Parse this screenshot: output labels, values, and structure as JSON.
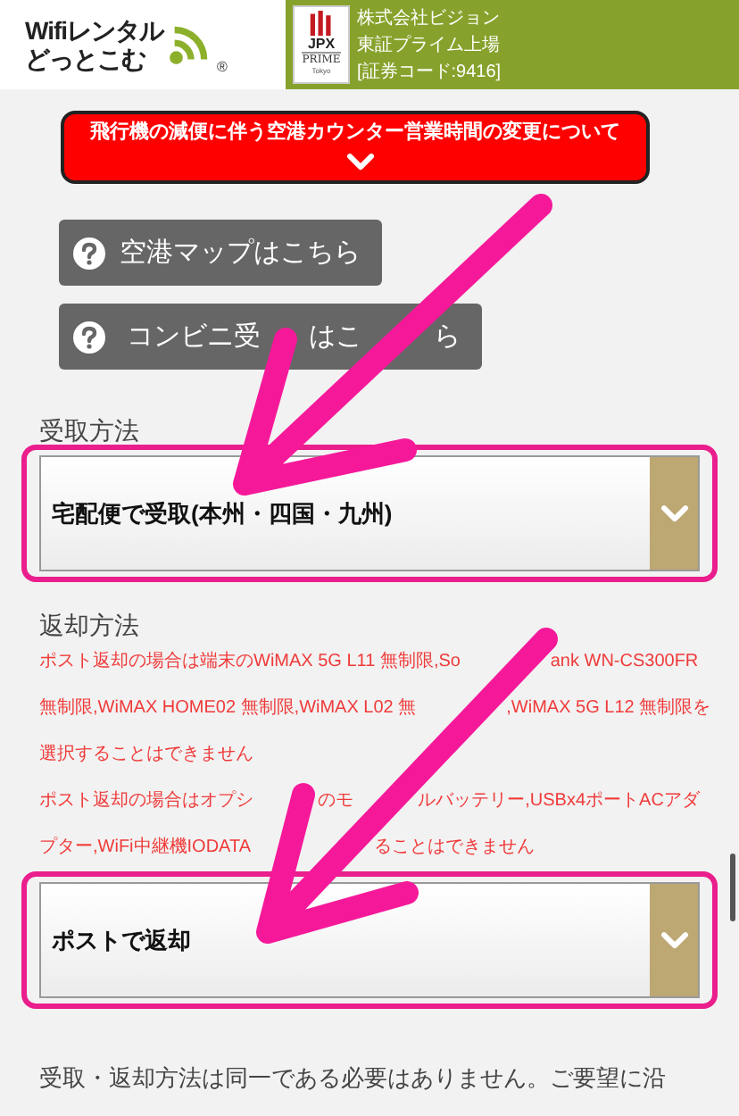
{
  "header": {
    "logo": {
      "line1": "Wifiレンタル",
      "line2": "どっとこむ",
      "mark": "®"
    },
    "jpx": {
      "name": "JPX",
      "market": "PRIME",
      "city": "Tokyo"
    },
    "company_lines": [
      "株式会社ビジョン",
      "東証プライム上場",
      "[証券コード:9416]"
    ]
  },
  "notice": {
    "text": "飛行機の減便に伴う空港カウンター営業時間の変更について"
  },
  "link_buttons": [
    {
      "visible_parts": [
        "空港マップはこちら"
      ]
    },
    {
      "visible_parts": [
        "コンビニ受",
        "はこ",
        "ら"
      ]
    }
  ],
  "pickup": {
    "label": "受取方法",
    "value": "宅配便で受取(本州・四国・九州)"
  },
  "return": {
    "label": "返却方法",
    "notes": [
      {
        "lines": [
          [
            "ポスト返却の場合は端末のWiMAX 5G L11 無制限,So",
            "ank WN-CS300FR"
          ],
          [
            "無制限,WiMAX HOME02 無制限,WiMAX L02 無",
            ",WiMAX 5G L12 無制限を"
          ],
          [
            "選択することはできません"
          ]
        ]
      },
      {
        "lines": [
          [
            "ポスト返却の場合はオプシ",
            "のモ",
            "ルバッテリー,USBx4ポートACアダ"
          ],
          [
            "プター,WiFi中継機IODATA",
            "ることはできません"
          ]
        ]
      }
    ],
    "value": "ポストで返却"
  },
  "footer_text": "受取・返却方法は同一である必要はありません。ご要望に沿"
}
